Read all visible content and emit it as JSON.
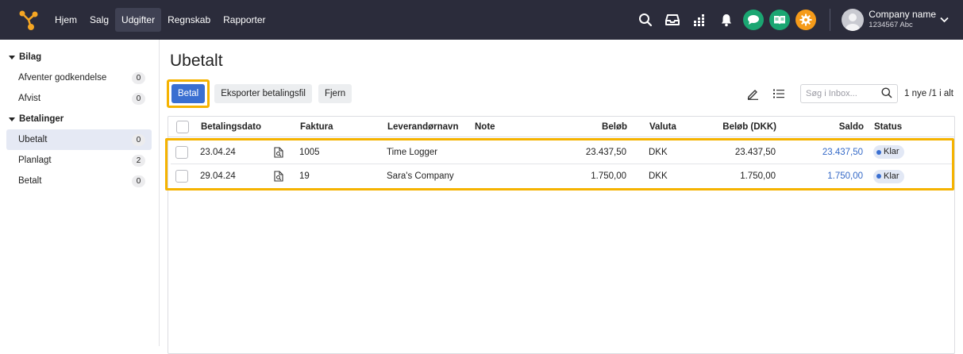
{
  "nav": {
    "items": [
      {
        "label": "Hjem",
        "active": false
      },
      {
        "label": "Salg",
        "active": false
      },
      {
        "label": "Udgifter",
        "active": true
      },
      {
        "label": "Regnskab",
        "active": false
      },
      {
        "label": "Rapporter",
        "active": false
      }
    ],
    "icons": [
      "search-icon",
      "inbox-icon",
      "apps-grid-icon",
      "bell-icon",
      "chat-icon",
      "book-icon",
      "gear-icon"
    ],
    "colors": {
      "bar": "#2b2c3b",
      "logo": "#f5a623",
      "chat": "#1ba672",
      "book": "#1ba672",
      "gear": "#f59b1a"
    }
  },
  "account": {
    "company_name": "Company name",
    "company_number": "1234567 Abc"
  },
  "sidebar": {
    "bilag": {
      "title": "Bilag",
      "items": [
        {
          "label": "Afventer godkendelse",
          "count": "0"
        },
        {
          "label": "Afvist",
          "count": "0"
        }
      ]
    },
    "betalinger": {
      "title": "Betalinger",
      "items": [
        {
          "label": "Ubetalt",
          "count": "0",
          "active": true
        },
        {
          "label": "Planlagt",
          "count": "2"
        },
        {
          "label": "Betalt",
          "count": "0"
        }
      ]
    }
  },
  "page": {
    "title": "Ubetalt"
  },
  "toolbar": {
    "pay_label": "Betal",
    "export_label": "Eksporter betalingsfil",
    "remove_label": "Fjern",
    "search_placeholder": "Søg i Inbox...",
    "pager": "1 nye /1 i alt"
  },
  "table": {
    "headers": {
      "date": "Betalingsdato",
      "invoice": "Faktura",
      "supplier": "Leverandørnavn",
      "note": "Note",
      "amount": "Beløb",
      "currency": "Valuta",
      "amount_dkk": "Beløb (DKK)",
      "balance": "Saldo",
      "status": "Status"
    },
    "rows": [
      {
        "date": "23.04.24",
        "invoice": "1005",
        "supplier": "Time Logger",
        "note": "",
        "amount": "23.437,50",
        "currency": "DKK",
        "amount_dkk": "23.437,50",
        "balance": "23.437,50",
        "status": "Klar"
      },
      {
        "date": "29.04.24",
        "invoice": "19",
        "supplier": "Sara's Company",
        "note": "",
        "amount": "1.750,00",
        "currency": "DKK",
        "amount_dkk": "1.750,00",
        "balance": "1.750,00",
        "status": "Klar"
      }
    ]
  }
}
